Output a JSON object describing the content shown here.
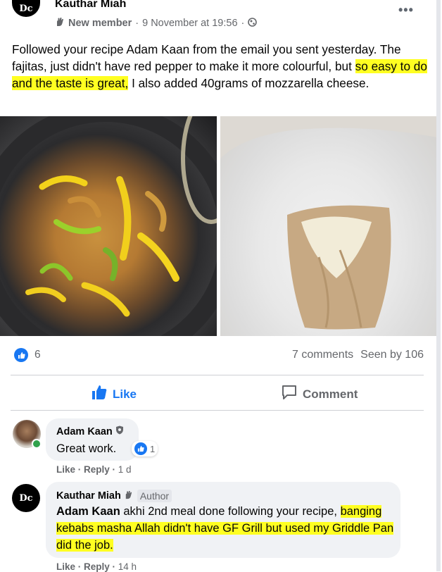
{
  "post": {
    "avatar_text": "Dc",
    "author": "Kauthar Miah",
    "badge": "New member",
    "timestamp": "9 November at 19:56",
    "separator": "·",
    "text_part1": "Followed your recipe Adam Kaan from the email you sent yesterday. The fajitas, just didn't have red pepper to make it more colourful, but ",
    "text_highlight": "so easy to do and the taste is great,",
    "text_part2": " I also added 40grams of mozzarella cheese.",
    "photos": [
      {
        "alt": "Chicken fajitas with green and yellow peppers in a frying pan"
      },
      {
        "alt": "Wrapped tortilla with cheese on a plate"
      }
    ]
  },
  "stats": {
    "like_count": "6",
    "comments": "7 comments",
    "seen_by": "Seen by 106"
  },
  "actions": {
    "like_label": "Like",
    "comment_label": "Comment"
  },
  "comments": [
    {
      "author": "Adam Kaan",
      "text": "Great work.",
      "reaction_count": "1",
      "like_label": "Like",
      "reply_label": "Reply",
      "time": "1 d"
    },
    {
      "author": "Kauthar Miah",
      "avatar_text": "Dc",
      "badge": "Author",
      "mention": "Adam Kaan",
      "text_part1": " akhi 2nd meal done following your recipe, ",
      "text_highlight": "banging kebabs masha Allah didn't have GF Grill but used my Griddle Pan did the job.",
      "like_label": "Like",
      "reply_label": "Reply",
      "time": "14 h"
    }
  ],
  "colors": {
    "accent": "#1877f2",
    "highlight": "#ffff21",
    "muted": "#65676b",
    "bubble": "#f0f2f5"
  }
}
